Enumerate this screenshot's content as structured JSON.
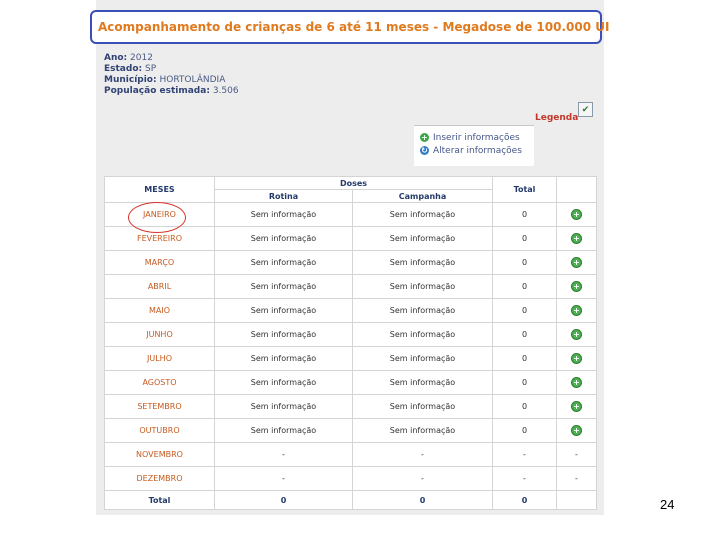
{
  "title": "Acompanhamento de crianças de 6 até 11 meses - Megadose de 100.000 UI",
  "info": [
    {
      "label": "Ano:",
      "value": "2012"
    },
    {
      "label": "Estado:",
      "value": "SP"
    },
    {
      "label": "Município:",
      "value": "HORTOLÂNDIA"
    },
    {
      "label": "População estimada:",
      "value": "3.506"
    }
  ],
  "legend": {
    "label": "Legenda",
    "icon": "legend-icon"
  },
  "actions": [
    {
      "label": "Inserir informações",
      "icon": "plus-icon"
    },
    {
      "label": "Alterar informações",
      "icon": "refresh-icon"
    }
  ],
  "table": {
    "headers": {
      "meses": "MESES",
      "doses": "Doses",
      "rotina": "Rotina",
      "campanha": "Campanha",
      "total": "Total"
    },
    "rows": [
      {
        "month": "JANEIRO",
        "rotina": "Sem informação",
        "campanha": "Sem informação",
        "total": "0",
        "action": "+"
      },
      {
        "month": "FEVEREIRO",
        "rotina": "Sem informação",
        "campanha": "Sem informação",
        "total": "0",
        "action": "+"
      },
      {
        "month": "MARÇO",
        "rotina": "Sem informação",
        "campanha": "Sem informação",
        "total": "0",
        "action": "+"
      },
      {
        "month": "ABRIL",
        "rotina": "Sem informação",
        "campanha": "Sem informação",
        "total": "0",
        "action": "+"
      },
      {
        "month": "MAIO",
        "rotina": "Sem informação",
        "campanha": "Sem informação",
        "total": "0",
        "action": "+"
      },
      {
        "month": "JUNHO",
        "rotina": "Sem informação",
        "campanha": "Sem informação",
        "total": "0",
        "action": "+"
      },
      {
        "month": "JULHO",
        "rotina": "Sem informação",
        "campanha": "Sem informação",
        "total": "0",
        "action": "+"
      },
      {
        "month": "AGOSTO",
        "rotina": "Sem informação",
        "campanha": "Sem informação",
        "total": "0",
        "action": "+"
      },
      {
        "month": "SETEMBRO",
        "rotina": "Sem informação",
        "campanha": "Sem informação",
        "total": "0",
        "action": "+"
      },
      {
        "month": "OUTUBRO",
        "rotina": "Sem informação",
        "campanha": "Sem informação",
        "total": "0",
        "action": "+"
      },
      {
        "month": "NOVEMBRO",
        "rotina": "-",
        "campanha": "-",
        "total": "-",
        "action": "-"
      },
      {
        "month": "DEZEMBRO",
        "rotina": "-",
        "campanha": "-",
        "total": "-",
        "action": "-"
      }
    ],
    "total_row": {
      "label": "Total",
      "rotina": "0",
      "campanha": "0",
      "total": "0"
    }
  },
  "page_number": "24",
  "colors": {
    "title": "#e07a1f",
    "border": "#3a4fb8",
    "month": "#c65a1f",
    "highlight": "#d9342b"
  }
}
